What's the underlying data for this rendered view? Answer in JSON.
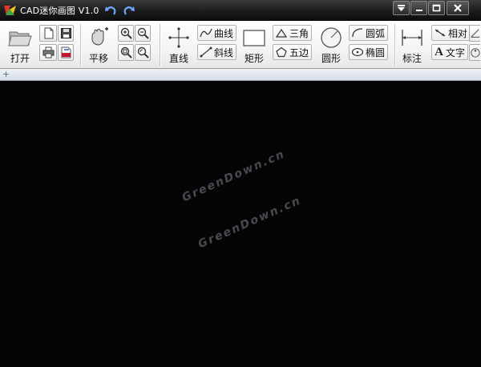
{
  "window": {
    "title": "CAD迷你画图 V1.0"
  },
  "toolbar": {
    "file": {
      "open_label": "打开"
    },
    "pan_label": "平移",
    "line_label": "直线",
    "curve_label": "曲线",
    "oblique_label": "斜线",
    "rect_label": "矩形",
    "triangle_label": "三角",
    "pentagon_label": "五边",
    "circle_label": "圆形",
    "arc_label": "圆弧",
    "ellipse_label": "椭圆",
    "dimension_label": "标注",
    "relative_label": "相对",
    "text_label": "文字",
    "text_icon_glyph": "A"
  },
  "tabs": {
    "add_glyph": "+"
  },
  "canvas": {
    "background": "#050507",
    "watermark_lines": [
      "GreenDown.cn",
      "GreenDown.cn"
    ]
  },
  "colors": {
    "accent_blue": "#2d5fbf",
    "pdf_red": "#c8102e"
  }
}
